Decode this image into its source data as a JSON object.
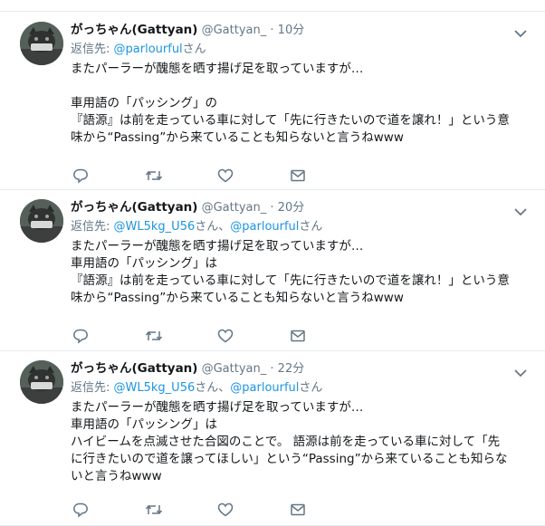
{
  "tweets": [
    {
      "name": "がっちゃん(Gattyan)",
      "handle": "@Gattyan_",
      "separator": "·",
      "time": "10分",
      "reply_label": "返信先:",
      "reply_to": [
        {
          "text": "@parlourful",
          "suffix": "さん"
        }
      ],
      "lines": [
        "またパーラーが醜態を晒す揚げ足を取っていますが…",
        "",
        "車用語の「パッシング」の",
        "『語源』は前を走っている車に対して「先に行きたいので道を譲れ！」という意",
        "味から“Passing”から来ていることも知らないと言うねwww"
      ]
    },
    {
      "name": "がっちゃん(Gattyan)",
      "handle": "@Gattyan_",
      "separator": "·",
      "time": "20分",
      "reply_label": "返信先:",
      "reply_to": [
        {
          "text": "@WL5kg_U56",
          "suffix": "さん、"
        },
        {
          "text": "@parlourful",
          "suffix": "さん"
        }
      ],
      "lines": [
        "またパーラーが醜態を晒す揚げ足を取っていますが…",
        "車用語の「パッシング」は",
        "『語源』は前を走っている車に対して「先に行きたいので道を譲れ！」という意",
        "味から“Passing”から来ていることも知らないと言うねwww"
      ]
    },
    {
      "name": "がっちゃん(Gattyan)",
      "handle": "@Gattyan_",
      "separator": "·",
      "time": "22分",
      "reply_label": "返信先:",
      "reply_to": [
        {
          "text": "@WL5kg_U56",
          "suffix": "さん、"
        },
        {
          "text": "@parlourful",
          "suffix": "さん"
        }
      ],
      "lines": [
        "またパーラーが醜態を晒す揚げ足を取っていますが…",
        "車用語の「パッシング」は",
        "ハイビームを点滅させた合図のことで。 語源は前を走っている車に対して「先",
        "に行きたいので道を譲ってほしい」という“Passing”から来ていることも知らな",
        "いと言うねwww"
      ]
    }
  ],
  "icons": [
    "reply-icon",
    "retweet-icon",
    "like-icon",
    "message-icon",
    "chevron-down-icon"
  ],
  "colors": {
    "link": "#1b95e0",
    "muted": "#657786",
    "text": "#14171a",
    "divider": "#e6ecf0"
  }
}
